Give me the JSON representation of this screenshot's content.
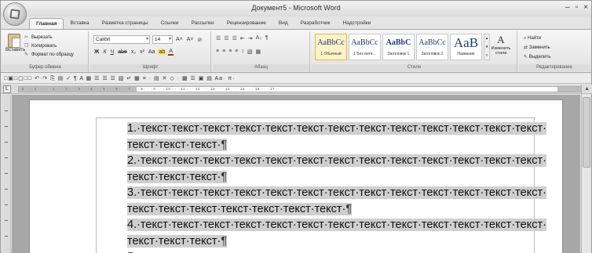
{
  "window": {
    "title": "Документ5 - Microsoft Word",
    "controls": [
      "–",
      "▫",
      "×"
    ]
  },
  "tabs": [
    {
      "label": "Главная",
      "active": true
    },
    {
      "label": "Вставка"
    },
    {
      "label": "Разметка страницы"
    },
    {
      "label": "Ссылки"
    },
    {
      "label": "Рассылки"
    },
    {
      "label": "Рецензирование"
    },
    {
      "label": "Вид"
    },
    {
      "label": "Разработчик"
    },
    {
      "label": "Надстройки"
    }
  ],
  "ribbon": {
    "clipboard": {
      "group_label": "Буфер обмена",
      "paste_label": "Вставить",
      "cut_label": "Вырезать",
      "copy_label": "Копировать",
      "format_painter_label": "Формат по образцу"
    },
    "font": {
      "group_label": "Шрифт",
      "font_name": "Calibri",
      "font_size": "14",
      "grow_label": "A˄",
      "shrink_label": "A˅",
      "clear_label": "⊘",
      "bold": "Ж",
      "italic": "К",
      "underline": "Ч",
      "strike": "abe",
      "subscript": "x₂",
      "superscript": "x²",
      "case": "Aa",
      "highlight": "ab",
      "color": "A"
    },
    "paragraph": {
      "group_label": "Абзац",
      "row1": [
        "☰",
        "☰",
        "☰",
        "⇤",
        "⇥",
        "A↓",
        "¶"
      ],
      "row2": [
        "≡",
        "≡",
        "≡",
        "≡",
        "↕",
        "▧",
        "▦"
      ]
    },
    "styles": {
      "group_label": "Стили",
      "items": [
        {
          "sample": "AaBbCc",
          "caption": "1 Обычный",
          "active": true
        },
        {
          "sample": "AaBbCc",
          "caption": "1 Без инте..."
        },
        {
          "sample": "AaBbC",
          "caption": "Заголовок 1"
        },
        {
          "sample": "AaBbCc",
          "caption": "Заголовок 2"
        },
        {
          "sample": "AaB",
          "caption": "Название",
          "big": true
        }
      ],
      "change_styles_label": "Изменить стили"
    },
    "editing": {
      "group_label": "Редактирование",
      "find_label": "Найти",
      "replace_label": "Заменить",
      "select_label": "Выделить"
    }
  },
  "quick_access": "□▣□▢□□ ↶·↷ ⎘ ▤ ✓ ¶ A ▦ ☰ ☰ ☰ ▧ ↵ ▦ ≡ · ▤ ✕ ◇ · ▦ ☰ ▣ ▤ Aa· π·",
  "ruler_text": "· 2 · · · 1 · · · · · 1 · · · 2 · · · 3 · · · 4 · · · 5 · · · 6 · · · 7 · · · 8 · · · 9 · · · 10 · · · 11 · · · 12 · · · 13 · · · 14 · · · 15 · · · 16 · · · 17",
  "document": {
    "lines": [
      {
        "text": "1.·текст·текст·текст·текст·текст·текст·текст·текст·текст·текст·текст·текст·текст·",
        "selected": true
      },
      {
        "text": "текст·текст·текст·",
        "pilcrow": "¶",
        "selected": true
      },
      {
        "text": "2.·текст·текст·текст·текст·текст·текст·текст·текст·текст·текст·текст·текст·текст·",
        "selected": true
      },
      {
        "text": "текст·текст·текст·",
        "pilcrow": "¶",
        "selected": true
      },
      {
        "text": "3.·текст·текст·текст·текст·текст·текст·текст·текст·текст·текст·текст·текст·текст·",
        "selected": true
      },
      {
        "text": "текст·текст·текст·текст·текст·текст·текст·",
        "pilcrow": "¶",
        "selected": true
      },
      {
        "text": "4.·текст·текст·текст·текст·текст·текст·текст·текст·текст·текст·текст·текст·текст·",
        "selected": true
      },
      {
        "text": "текст·текст·текст·",
        "pilcrow": "¶",
        "selected": true
      },
      {
        "text": "",
        "pilcrow": "¶",
        "selected": false
      }
    ]
  },
  "colors": {
    "selection": "#cfcfcf",
    "workspace": "#a7a7a7",
    "ribbon": "#e2e2e2"
  }
}
